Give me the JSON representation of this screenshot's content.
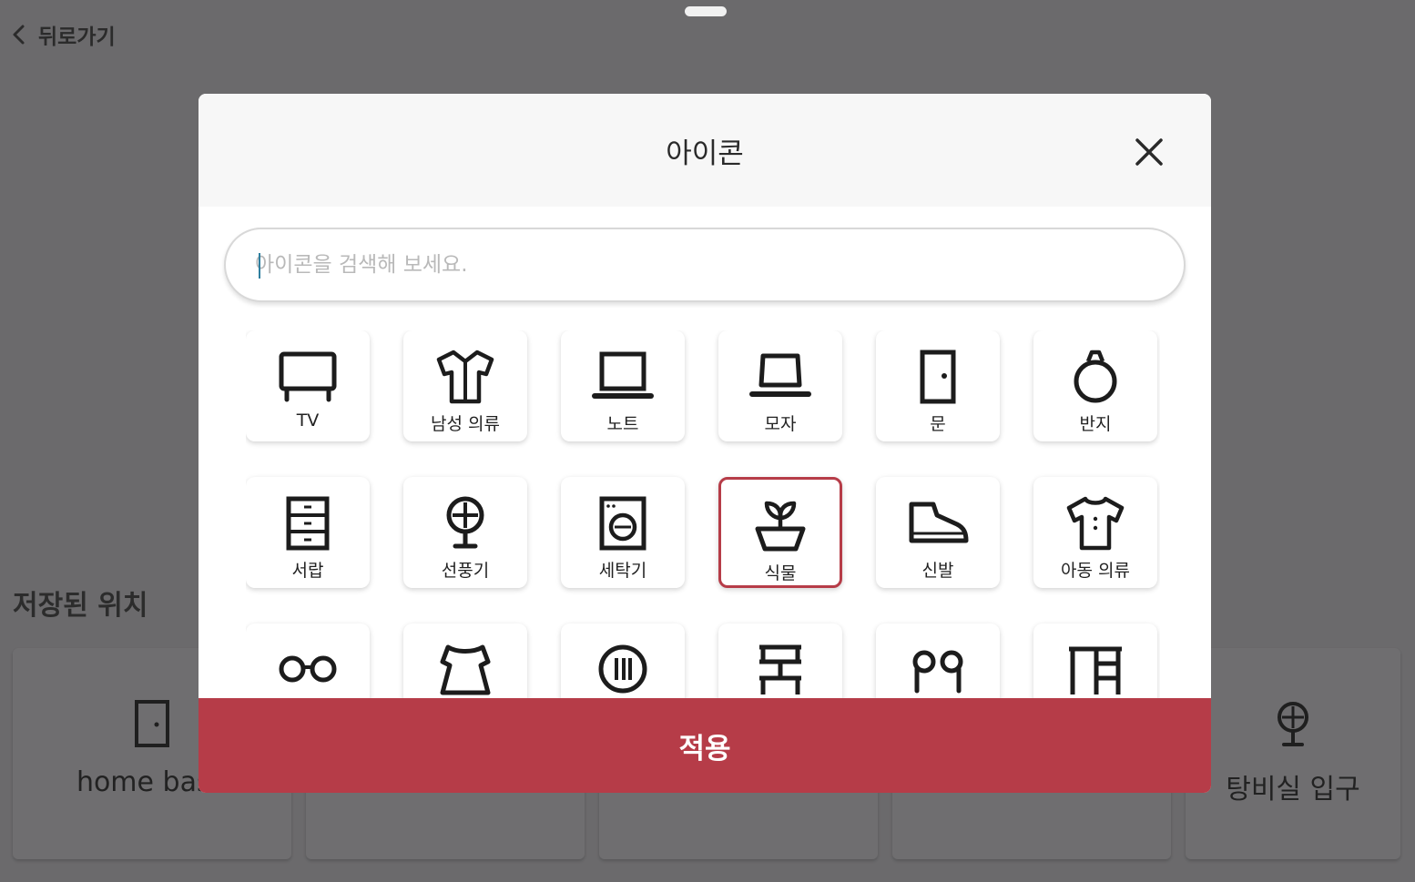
{
  "back": {
    "label": "뒤로가기"
  },
  "saved": {
    "title": "저장된 위치",
    "cards": [
      {
        "label": "home base",
        "icon": "door-icon"
      },
      {
        "label": "",
        "icon": ""
      },
      {
        "label": "",
        "icon": ""
      },
      {
        "label": "",
        "icon": ""
      },
      {
        "label": "탕비실 입구",
        "icon": "fan-icon"
      }
    ]
  },
  "modal": {
    "title": "아이콘",
    "search_placeholder": "아이콘을 검색해 보세요.",
    "apply_label": "적용",
    "icons": [
      {
        "label": "TV",
        "icon": "tv-icon"
      },
      {
        "label": "남성 의류",
        "icon": "mens-clothing-icon"
      },
      {
        "label": "노트",
        "icon": "laptop-icon"
      },
      {
        "label": "모자",
        "icon": "hat-icon"
      },
      {
        "label": "문",
        "icon": "door-icon"
      },
      {
        "label": "반지",
        "icon": "ring-icon"
      },
      {
        "label": "서랍",
        "icon": "drawer-icon"
      },
      {
        "label": "선풍기",
        "icon": "fan-icon"
      },
      {
        "label": "세탁기",
        "icon": "washing-machine-icon"
      },
      {
        "label": "식물",
        "icon": "plant-icon",
        "selected": true
      },
      {
        "label": "신발",
        "icon": "shoe-icon"
      },
      {
        "label": "아동 의류",
        "icon": "kids-clothing-icon"
      },
      {
        "label": "",
        "icon": "glasses-icon"
      },
      {
        "label": "",
        "icon": "dress-icon"
      },
      {
        "label": "",
        "icon": "plate-icon"
      },
      {
        "label": "",
        "icon": "shelf-icon"
      },
      {
        "label": "",
        "icon": "earphones-icon"
      },
      {
        "label": "",
        "icon": "desk-icon"
      }
    ]
  },
  "colors": {
    "accent": "#b63c48",
    "overlay": "#6b6a6c"
  }
}
